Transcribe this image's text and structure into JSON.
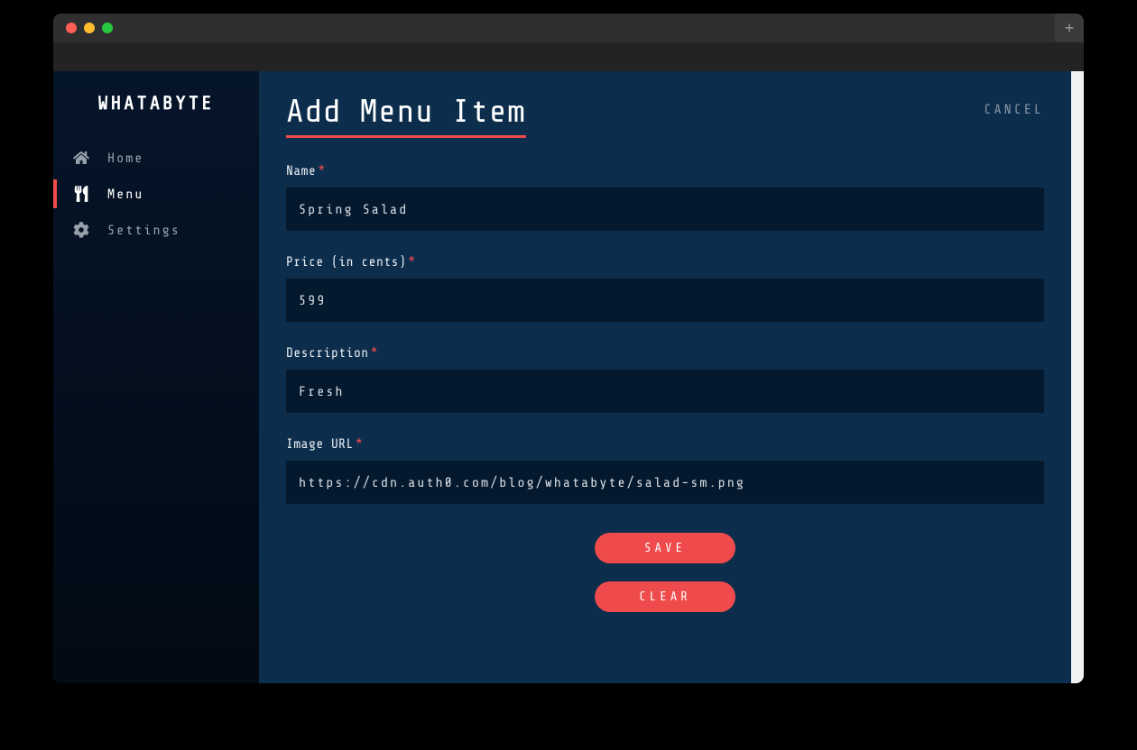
{
  "window": {
    "newTabGlyph": "+"
  },
  "sidebar": {
    "brand": "WHATABYTE",
    "items": [
      {
        "label": "Home"
      },
      {
        "label": "Menu"
      },
      {
        "label": "Settings"
      }
    ]
  },
  "header": {
    "title": "Add Menu Item",
    "cancel": "CANCEL"
  },
  "form": {
    "fields": {
      "name": {
        "label": "Name",
        "value": "Spring Salad"
      },
      "price": {
        "label": "Price (in cents)",
        "value": "599"
      },
      "description": {
        "label": "Description",
        "value": "Fresh"
      },
      "image": {
        "label": "Image URL",
        "value": "https://cdn.auth0.com/blog/whatabyte/salad-sm.png"
      }
    },
    "requiredMark": "*",
    "actions": {
      "save": "SAVE",
      "clear": "CLEAR"
    }
  }
}
